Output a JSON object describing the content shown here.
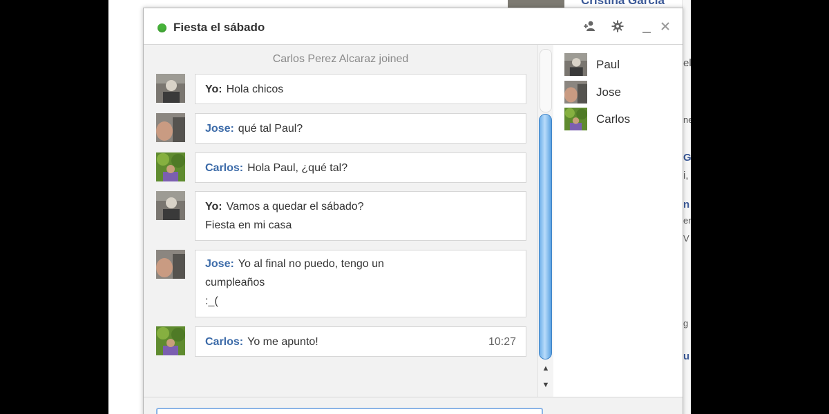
{
  "background": {
    "top_name": "Cristina Garcia",
    "right_fragments": [
      "el",
      "ne",
      "G",
      "i,",
      "n",
      "er",
      "V",
      "g",
      "u"
    ]
  },
  "chat": {
    "title": "Fiesta el sábado",
    "status_color": "#47b33a",
    "joined_notice": "Carlos Perez Alcaraz joined",
    "messages": [
      {
        "sender": "Yo:",
        "lines": [
          "Hola chicos"
        ],
        "time": ""
      },
      {
        "sender": "Jose:",
        "lines": [
          "qué tal Paul?"
        ],
        "time": ""
      },
      {
        "sender": "Carlos:",
        "lines": [
          "Hola Paul, ¿qué tal?"
        ],
        "time": ""
      },
      {
        "sender": "Yo:",
        "lines": [
          "Vamos a quedar el sábado?",
          "Fiesta en mi casa"
        ],
        "time": ""
      },
      {
        "sender": "Jose:",
        "lines": [
          "Yo al final no puedo, tengo un",
          "cumpleaños",
          ":_("
        ],
        "time": ""
      },
      {
        "sender": "Carlos:",
        "lines": [
          "Yo me apunto!"
        ],
        "time": "10:27"
      }
    ],
    "participants": [
      "Paul",
      "Jose",
      "Carlos"
    ],
    "input_placeholder": ""
  },
  "icons": {
    "add_person": "add-person-icon",
    "settings": "gear-icon",
    "minimize": "minimize-icon",
    "close": "close-icon"
  }
}
